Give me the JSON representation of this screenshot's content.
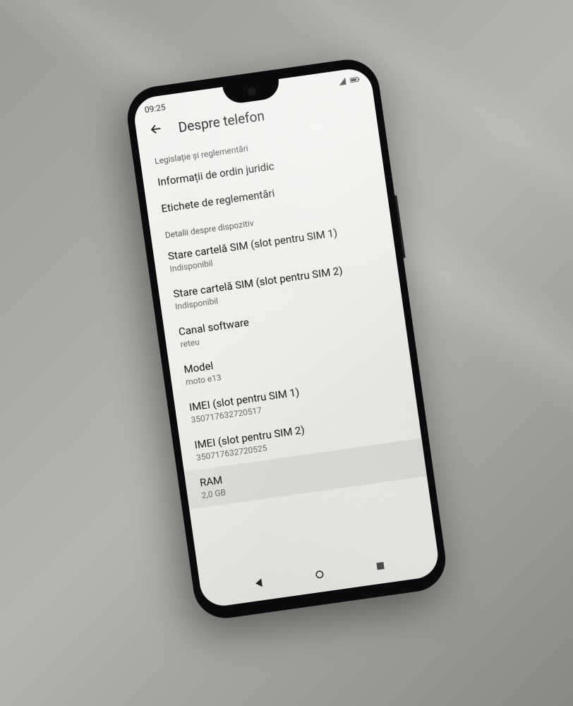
{
  "statusbar": {
    "time": "09:25"
  },
  "appbar": {
    "title": "Despre telefon"
  },
  "sections": {
    "legal": {
      "header": "Legislație și reglementări",
      "rows": {
        "legal_info": {
          "title": "Informații de ordin juridic"
        },
        "reg_labels": {
          "title": "Etichete de reglementări"
        }
      }
    },
    "device": {
      "header": "Detalii despre dispozitiv",
      "rows": {
        "sim1": {
          "title": "Stare cartelă SIM (slot pentru SIM 1)",
          "sub": "Indisponibil"
        },
        "sim2": {
          "title": "Stare cartelă SIM (slot pentru SIM 2)",
          "sub": "Indisponibil"
        },
        "channel": {
          "title": "Canal software",
          "sub": "reteu"
        },
        "model": {
          "title": "Model",
          "sub": "moto e13"
        },
        "imei1": {
          "title": "IMEI (slot pentru SIM 1)",
          "sub": "350717632720517"
        },
        "imei2": {
          "title": "IMEI (slot pentru SIM 2)",
          "sub": "350717632720525"
        },
        "ram": {
          "title": "RAM",
          "sub": "2,0 GB"
        }
      }
    }
  }
}
